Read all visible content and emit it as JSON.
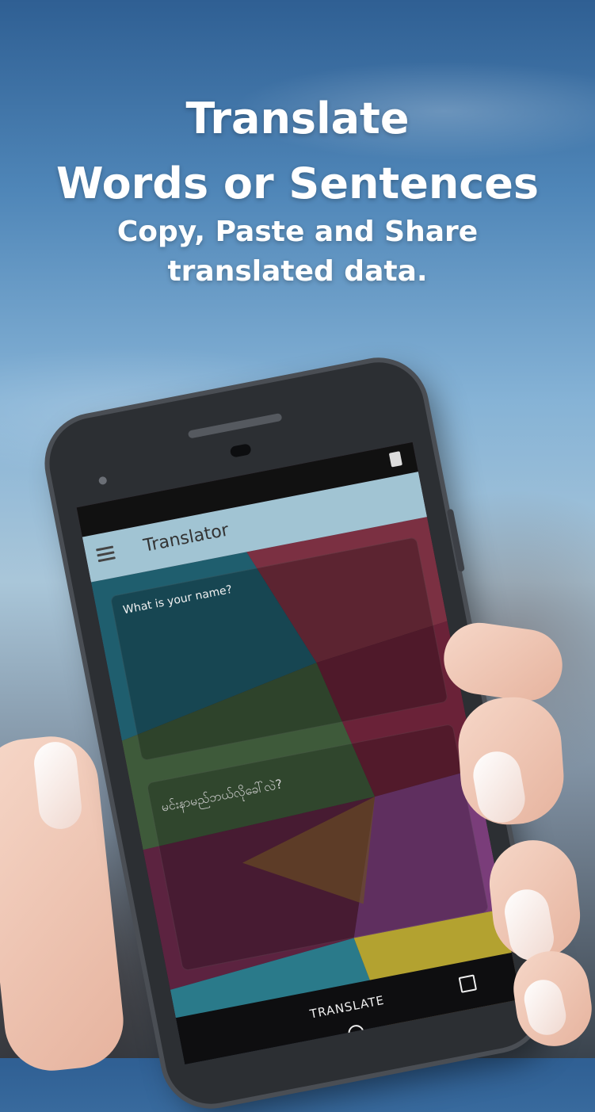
{
  "promo": {
    "line1": "Translate",
    "line2": "Words or Sentences",
    "line3": "Copy, Paste and Share",
    "line4": "translated data."
  },
  "app": {
    "title": "Translator",
    "input_text": "What is your name?",
    "output_text": "မင်းနာမည်ဘယ်လိုခေါ်လဲ?",
    "translate_button": "TRANSLATE"
  },
  "icons": {
    "menu": "menu-icon",
    "document": "document-icon",
    "recents": "square-icon",
    "home": "circle-icon"
  },
  "colors": {
    "headline": "#ffffff",
    "appbar": "#aad2e1",
    "navbar": "#0e0e10"
  }
}
